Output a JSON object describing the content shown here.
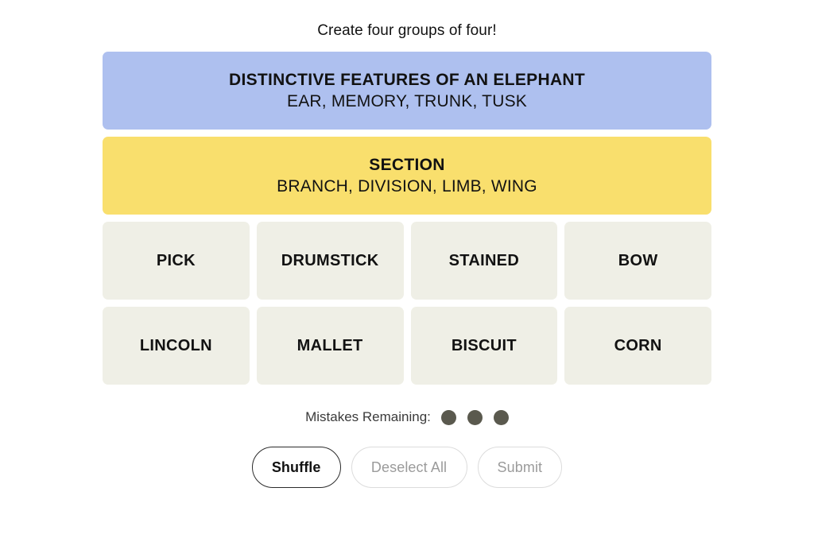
{
  "instruction": "Create four groups of four!",
  "colors": {
    "group_purple": "#aec0ef",
    "group_yellow": "#f9df6d",
    "tile": "#efefe6",
    "dot": "#5a594e",
    "text": "#121212",
    "muted": "#9b9b9b"
  },
  "solved_groups": [
    {
      "title": "DISTINCTIVE FEATURES OF AN ELEPHANT",
      "words": "EAR, MEMORY, TRUNK, TUSK",
      "color": "#aec0ef"
    },
    {
      "title": "SECTION",
      "words": "BRANCH, DIVISION, LIMB, WING",
      "color": "#f9df6d"
    }
  ],
  "tile_rows": [
    [
      "PICK",
      "DRUMSTICK",
      "STAINED",
      "BOW"
    ],
    [
      "LINCOLN",
      "MALLET",
      "BISCUIT",
      "CORN"
    ]
  ],
  "mistakes": {
    "label": "Mistakes Remaining:",
    "remaining": 3
  },
  "controls": {
    "shuffle": "Shuffle",
    "deselect": "Deselect All",
    "submit": "Submit"
  }
}
